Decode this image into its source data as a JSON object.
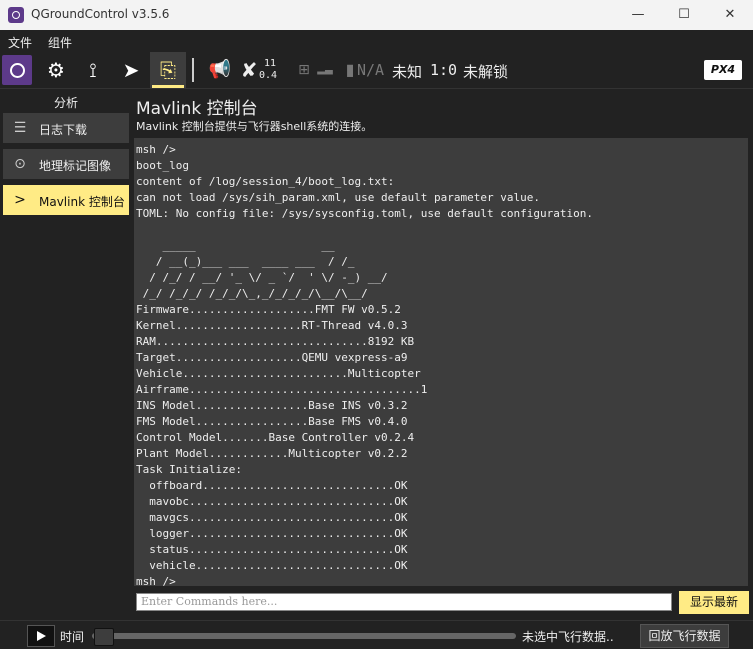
{
  "window": {
    "title": "QGroundControl v3.5.6",
    "minimize": "—",
    "maximize": "☐",
    "close": "✕"
  },
  "menu": {
    "file": "文件",
    "widgets": "组件"
  },
  "toolbar": {
    "gps_count": "11",
    "gps_hdop": "0.4",
    "battery": "N/A",
    "flight_mode": "未知",
    "vehicle_id": "1:0",
    "arm_state": "未解锁",
    "logo": "PX4"
  },
  "sidebar": {
    "title": "分析",
    "items": [
      {
        "label": "日志下载",
        "icon": "list-icon"
      },
      {
        "label": "地理标记图像",
        "icon": "map-pin-icon"
      },
      {
        "label": "Mavlink 控制台",
        "icon": "chevron-right-icon"
      }
    ]
  },
  "page": {
    "title": "Mavlink 控制台",
    "description": "Mavlink 控制台提供与飞行器shell系统的连接。"
  },
  "console": {
    "lines": [
      "msh />",
      "boot_log",
      "content of /log/session_4/boot_log.txt:",
      "can not load /sys/sih_param.xml, use default parameter value.",
      "TOML: No config file: /sys/sysconfig.toml, use default configuration.",
      "",
      "    _____                   __",
      "   / __(_)___ ___  ____ ___  / /_",
      "  / /_/ / __/ '_ \\/ _ `/  ' \\/ -_) __/",
      " /_/ /_/_/ /_/_/\\_,_/_/_/_/\\__/\\__/",
      "Firmware...................FMT FW v0.5.2",
      "Kernel...................RT-Thread v4.0.3",
      "RAM................................8192 KB",
      "Target...................QEMU vexpress-a9",
      "Vehicle.........................Multicopter",
      "Airframe...................................1",
      "INS Model.................Base INS v0.3.2",
      "FMS Model.................Base FMS v0.4.0",
      "Control Model.......Base Controller v0.2.4",
      "Plant Model............Multicopter v0.2.2",
      "Task Initialize:",
      "  offboard.............................OK",
      "  mavobc...............................OK",
      "  mavgcs...............................OK",
      "  logger...............................OK",
      "  status...............................OK",
      "  vehicle..............................OK",
      "msh />"
    ],
    "input_placeholder": "Enter Commands here...",
    "show_latest": "显示最新"
  },
  "bottom": {
    "time_label": "时间",
    "playback_progress": 0,
    "status": "未选中飞行数据..",
    "replay_button": "回放飞行数据"
  },
  "colors": {
    "accent": "#ffeb85",
    "brand": "#5d3a8a",
    "panel": "#3d3d3d",
    "background": "#222222"
  }
}
